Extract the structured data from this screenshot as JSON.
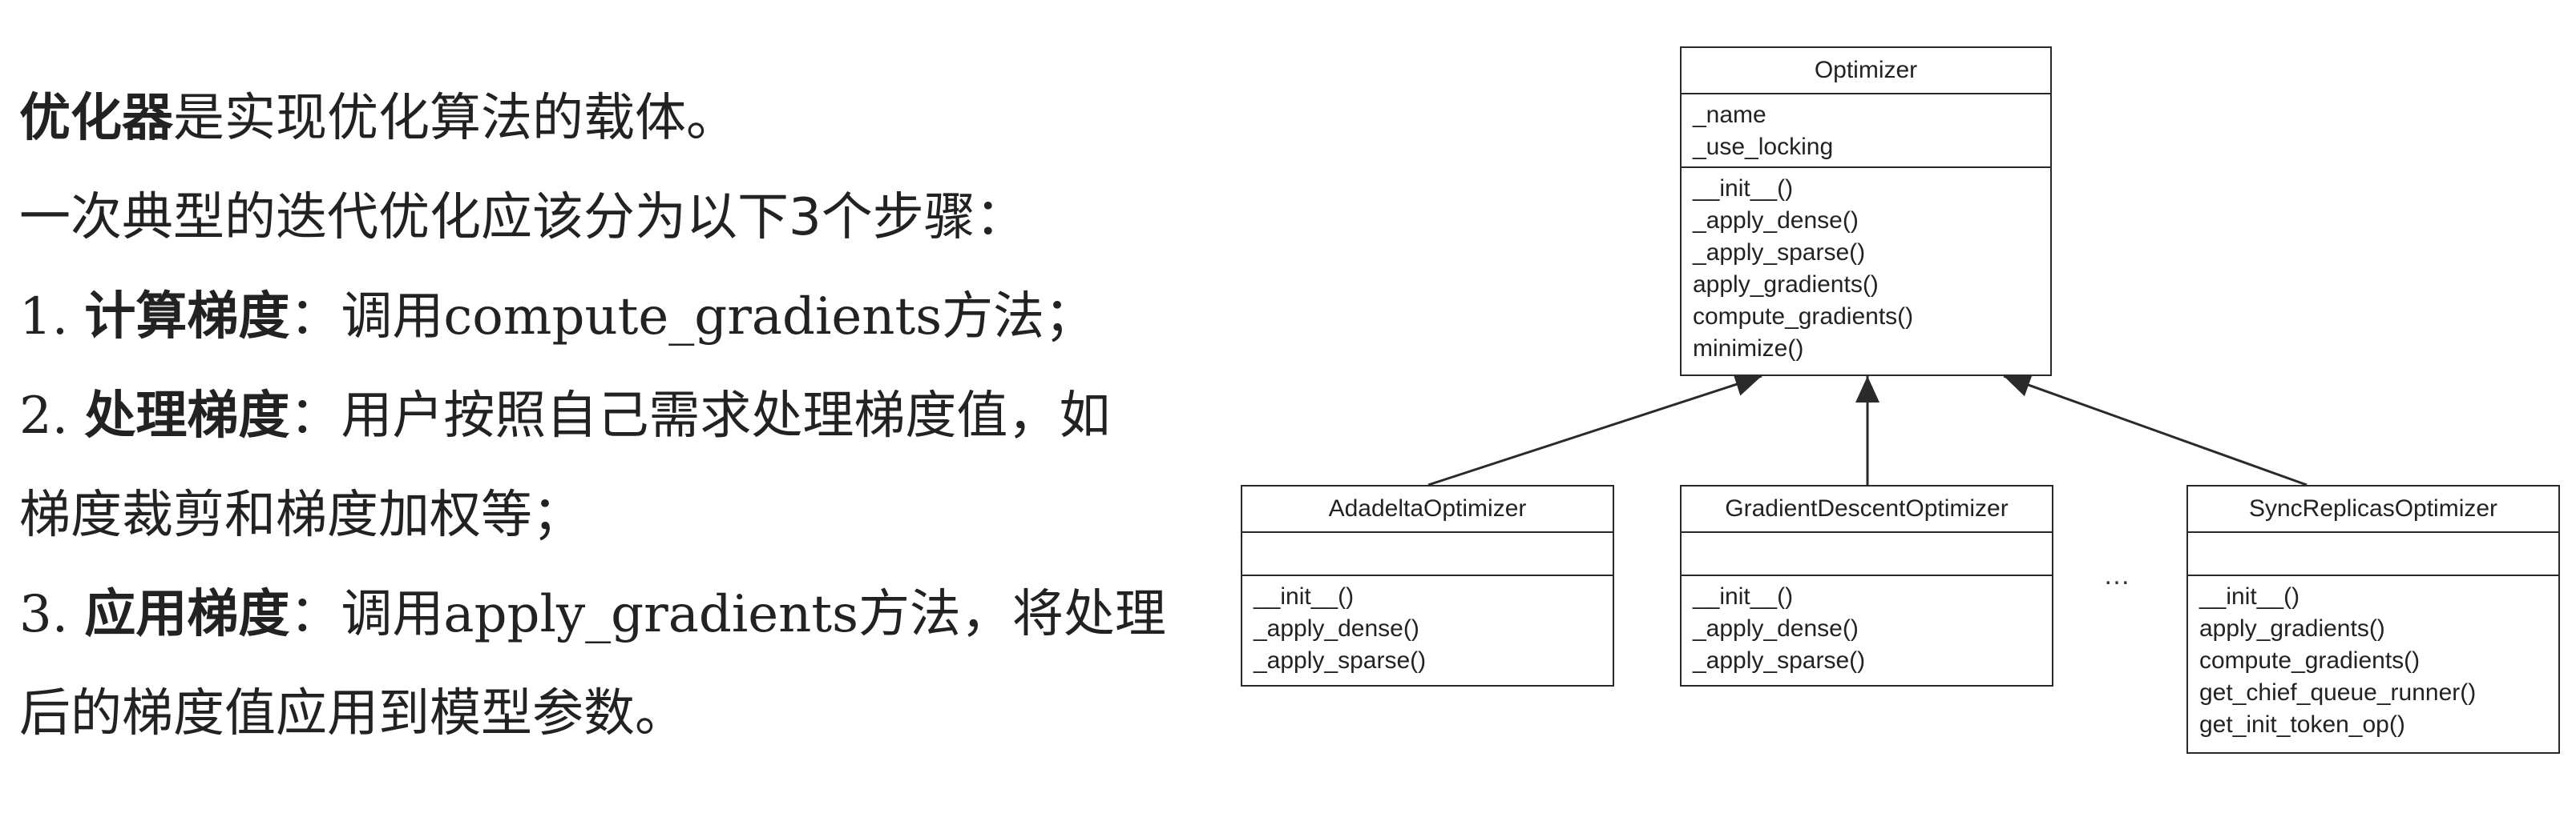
{
  "text": {
    "l1_bold": "优化器",
    "l1_rest": "是实现优化算法的载体。",
    "l2": "一次典型的迭代优化应该分为以下3个步骤：",
    "l3_num": "1. ",
    "l3_bold": "计算梯度",
    "l3_a": "：调用",
    "l3_code": "compute_gradients",
    "l3_b": "方法；",
    "l4_num": "2. ",
    "l4_bold": "处理梯度",
    "l4_rest": "：用户按照自己需求处理梯度值，如",
    "l5": "梯度裁剪和梯度加权等；",
    "l6_num": "3. ",
    "l6_bold": "应用梯度",
    "l6_a": "：调用",
    "l6_code": "apply_gradients",
    "l6_b": "方法，将处理",
    "l7": "后的梯度值应用到模型参数。"
  },
  "uml": {
    "optimizer": {
      "name": "Optimizer",
      "attributes": [
        "_name",
        "_use_locking"
      ],
      "methods": [
        "__init__()",
        "_apply_dense()",
        "_apply_sparse()",
        "apply_gradients()",
        "compute_gradients()",
        "minimize()"
      ]
    },
    "adadelta": {
      "name": "AdadeltaOptimizer",
      "methods": [
        "__init__()",
        "_apply_dense()",
        "_apply_sparse()"
      ]
    },
    "gradient_descent": {
      "name": "GradientDescentOptimizer",
      "methods": [
        "__init__()",
        "_apply_dense()",
        "_apply_sparse()"
      ]
    },
    "sync_replicas": {
      "name": "SyncReplicasOptimizer",
      "methods": [
        "__init__()",
        "apply_gradients()",
        "compute_gradients()",
        "get_chief_queue_runner()",
        "get_init_token_op()"
      ]
    },
    "ellipsis": "…"
  }
}
